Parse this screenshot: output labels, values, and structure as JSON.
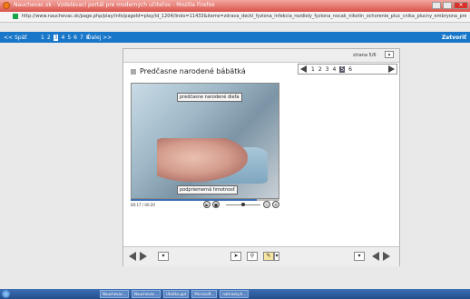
{
  "window": {
    "title": "Nauchevac.sk - Vzdelávací portál pre moderných učiteľov - Mozilla Firefox",
    "url": "http://www.nauchevac.sk/page.php/play/info/pageId=play/id_1204/lindo=11433&items=zdrava_deckl_fyziona_infekcia_rozdiely_fyziona_nocak_nikotin_ochorenie_pluc_cnika_plucny_embryona_predcasny_narodene"
  },
  "top_nav": {
    "prev_label": "<< Späť",
    "pages": [
      "1",
      "2",
      "3",
      "4",
      "5",
      "6",
      "7",
      "8"
    ],
    "current_page": "3",
    "next_label": "Ďalej >>",
    "close_label": "Zatvoriť"
  },
  "viewer": {
    "page_info": "strana 5/6",
    "slide_title": "Predčasne narodené bábätká",
    "slide_numbers": [
      "1",
      "2",
      "3",
      "4",
      "5",
      "6"
    ],
    "active_slide": "5",
    "photo_labels": {
      "top": "predčasne narodené dieťa",
      "bottom": "podpriemerná hmotnosť"
    },
    "player": {
      "time": "00:17 / 00:20",
      "progress": 0.85
    }
  },
  "taskbar": {
    "items": [
      "Nauchevac...",
      "Nauchevac...",
      "Ukážka.ppt",
      "Microsoft...",
      "nahravky.h..."
    ]
  },
  "colors": {
    "accent": "#1977c9",
    "titlebar": "#d9534a"
  }
}
